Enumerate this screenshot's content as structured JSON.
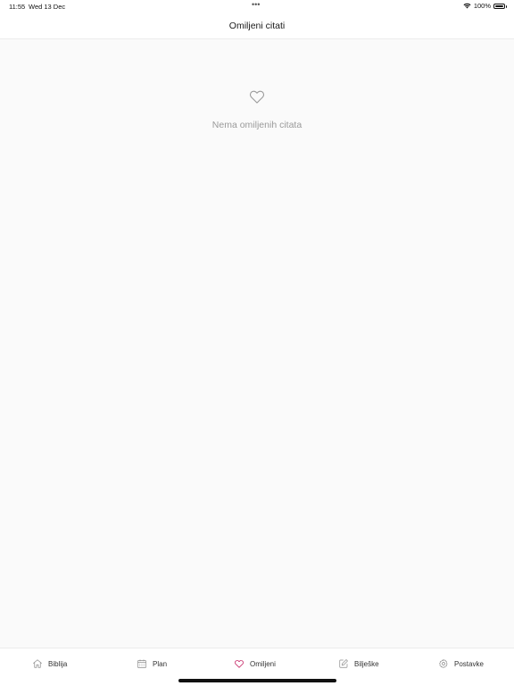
{
  "status_bar": {
    "time": "11:55",
    "date": "Wed 13 Dec",
    "dots": "•••",
    "battery": "100%"
  },
  "header": {
    "title": "Omiljeni citati"
  },
  "empty_state": {
    "icon": "heart-outline-icon",
    "message": "Nema omiljenih citata"
  },
  "tab_bar": {
    "items": [
      {
        "label": "Biblija",
        "icon": "home-icon",
        "active": false
      },
      {
        "label": "Plan",
        "icon": "calendar-icon",
        "active": false
      },
      {
        "label": "Omiljeni",
        "icon": "heart-icon",
        "active": true
      },
      {
        "label": "Bilješke",
        "icon": "edit-icon",
        "active": false
      },
      {
        "label": "Postavke",
        "icon": "gear-icon",
        "active": false
      }
    ]
  },
  "colors": {
    "background": "#fafafa",
    "active_icon": "#c2185b",
    "inactive_icon": "#8a8a8a",
    "empty_text": "#9a9a9a"
  }
}
